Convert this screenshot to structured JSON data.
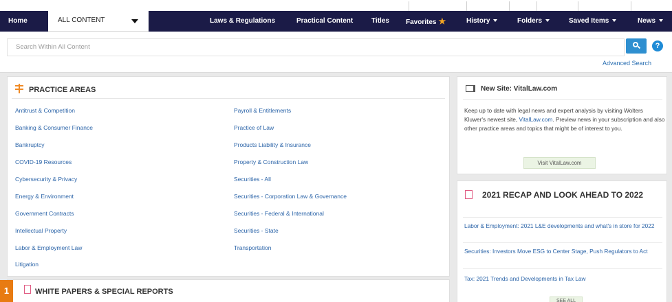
{
  "nav": {
    "home": "Home",
    "scope": "ALL CONTENT",
    "items": [
      {
        "label": "Laws & Regulations"
      },
      {
        "label": "Practical Content"
      },
      {
        "label": "Titles"
      },
      {
        "label": "Favorites"
      },
      {
        "label": "History"
      },
      {
        "label": "Folders"
      },
      {
        "label": "Saved Items"
      },
      {
        "label": "News"
      }
    ]
  },
  "search": {
    "placeholder": "Search Within All Content",
    "advanced": "Advanced Search",
    "help": "?"
  },
  "practice_areas": {
    "title": "PRACTICE AREAS",
    "left": [
      "Antitrust & Competition",
      "Banking & Consumer Finance",
      "Bankruptcy",
      "COVID-19 Resources",
      "Cybersecurity & Privacy",
      "Energy & Environment",
      "Government Contracts",
      "Intellectual Property",
      "Labor & Employment Law",
      "Litigation"
    ],
    "right": [
      "Payroll & Entitlements",
      "Practice of Law",
      "Products Liability & Insurance",
      "Property & Construction Law",
      "Securities - All",
      "Securities - Corporation Law & Governance",
      "Securities - Federal & International",
      "Securities - State",
      "Transportation"
    ]
  },
  "white_papers": {
    "title": "WHITE PAPERS & SPECIAL REPORTS",
    "badge": "1"
  },
  "new_site": {
    "title": "New Site: VitalLaw.com",
    "body_before": "Keep up to date with legal news and expert analysis by visiting Wolters Kluwer's newest site, ",
    "body_link": "VitalLaw.com",
    "body_after": ". Preview news in your subscription and also other practice areas and topics that might be of interest to you.",
    "button": "Visit VitalLaw.com"
  },
  "recap": {
    "title": "2021 RECAP AND LOOK AHEAD TO 2022",
    "items": [
      "Labor & Employment: 2021 L&E developments and what's in store for 2022",
      "Securities: Investors Move ESG to Center Stage, Push Regulators to Act",
      "Tax: 2021 Trends and Developments in Tax Law"
    ],
    "see_all": "SEE ALL"
  }
}
